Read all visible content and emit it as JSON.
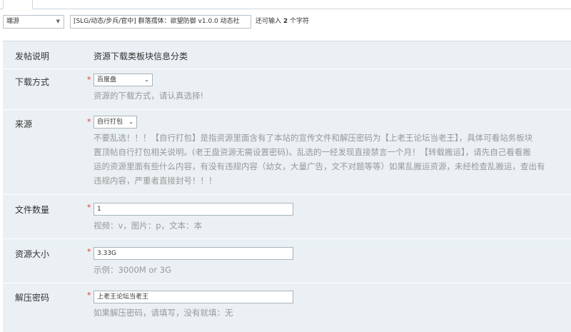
{
  "header": {
    "type_select": "端游",
    "title_value": "[SLG/动态/步兵/官中] 群落孺体：欲望防御 v1.0.0 动态社",
    "remain_prefix": "还可输入",
    "remain_count": "2",
    "remain_suffix": "个字符"
  },
  "form": {
    "notice": {
      "label": "发帖说明",
      "text": "资源下载类板块信息分类"
    },
    "download_method": {
      "label": "下载方式",
      "value": "百度盘",
      "hint": "资源的下载方式，请认真选择!"
    },
    "source": {
      "label": "来源",
      "value": "自行打包",
      "hint_lines": [
        "不要乱选！！！【自行打包】是指资源里面含有了本站的宣传文件和解压密码为【上老王论坛当老王】，具体可看站务板块",
        "置顶帖自行打包相关说明。(老王盘资源无需设置密码)。乱选的一经发现直接禁言一个月！【转载搬运】，请先自己看看搬",
        "运的资源里面有些什么内容，有没有违规内容（幼女，大量广告，文不对题等等）如果乱搬运资源，未经检查乱搬运，查出有",
        "违规内容，严重者直接封号！！！"
      ]
    },
    "file_count": {
      "label": "文件数量",
      "value": "1",
      "hint": "视频：v，图片：p，文本：本"
    },
    "size": {
      "label": "资源大小",
      "value": "3.33G",
      "hint": "示例：3000M or 3G"
    },
    "password": {
      "label": "解压密码",
      "value": "上老王论坛当老王",
      "hint": "如果解压密码，请填写，没有就填：无"
    },
    "required_mark": "*"
  }
}
